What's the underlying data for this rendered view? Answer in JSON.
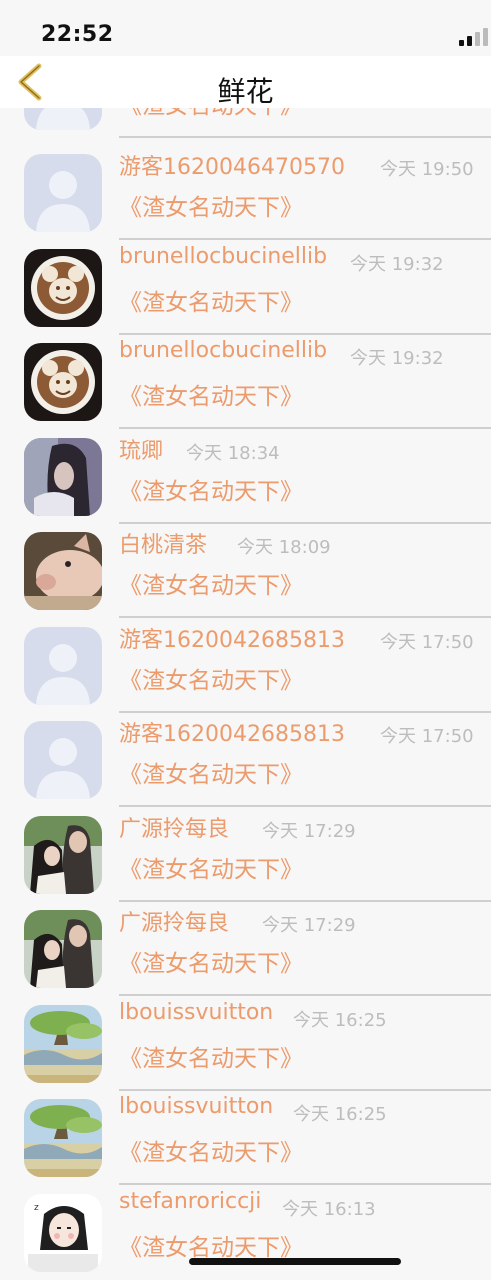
{
  "status_bar": {
    "time": "22:52",
    "signal": "signal-bars-icon"
  },
  "nav": {
    "back_icon": "chevron-left-icon",
    "title": "鲜花",
    "accent": "#e0c060"
  },
  "gift_text": "《渣女名动天下》",
  "colors": {
    "name": "#ec9b6c",
    "timestamp": "#bdbdbd",
    "divider": "#cfcfcf",
    "accent": "#ec9b6c"
  },
  "rows": [
    {
      "name": "",
      "time": "",
      "gift": "《渣女名动天下》",
      "avatar": "default-avatar"
    },
    {
      "name": "游客1620046470570",
      "time": "今天 19:50",
      "gift": "《渣女名动天下》",
      "avatar": "default-avatar"
    },
    {
      "name": "brunellocbucinellib",
      "time": "今天 19:32",
      "gift": "《渣女名动天下》",
      "avatar": "latte-art-avatar"
    },
    {
      "name": "brunellocbucinellib",
      "time": "今天 19:32",
      "gift": "《渣女名动天下》",
      "avatar": "latte-art-avatar"
    },
    {
      "name": "琉卿",
      "time": "今天 18:34",
      "gift": "《渣女名动天下》",
      "avatar": "girl-photo-avatar"
    },
    {
      "name": "白桃清茶",
      "time": "今天 18:09",
      "gift": "《渣女名动天下》",
      "avatar": "pig-photo-avatar"
    },
    {
      "name": "游客1620042685813",
      "time": "今天 17:50",
      "gift": "《渣女名动天下》",
      "avatar": "default-avatar"
    },
    {
      "name": "游客1620042685813",
      "time": "今天 17:50",
      "gift": "《渣女名动天下》",
      "avatar": "default-avatar"
    },
    {
      "name": "广源拎每良",
      "time": "今天 17:29",
      "gift": "《渣女名动天下》",
      "avatar": "couple-photo-avatar"
    },
    {
      "name": "广源拎每良",
      "time": "今天 17:29",
      "gift": "《渣女名动天下》",
      "avatar": "couple-photo-avatar"
    },
    {
      "name": "lbouissvuitton",
      "time": "今天 16:25",
      "gift": "《渣女名动天下》",
      "avatar": "landscape-painting-avatar"
    },
    {
      "name": "lbouissvuitton",
      "time": "今天 16:25",
      "gift": "《渣女名动天下》",
      "avatar": "landscape-painting-avatar"
    },
    {
      "name": "stefanroriccji",
      "time": "今天 16:13",
      "gift": "《渣女名动天下》",
      "avatar": "cartoon-girl-avatar"
    }
  ]
}
